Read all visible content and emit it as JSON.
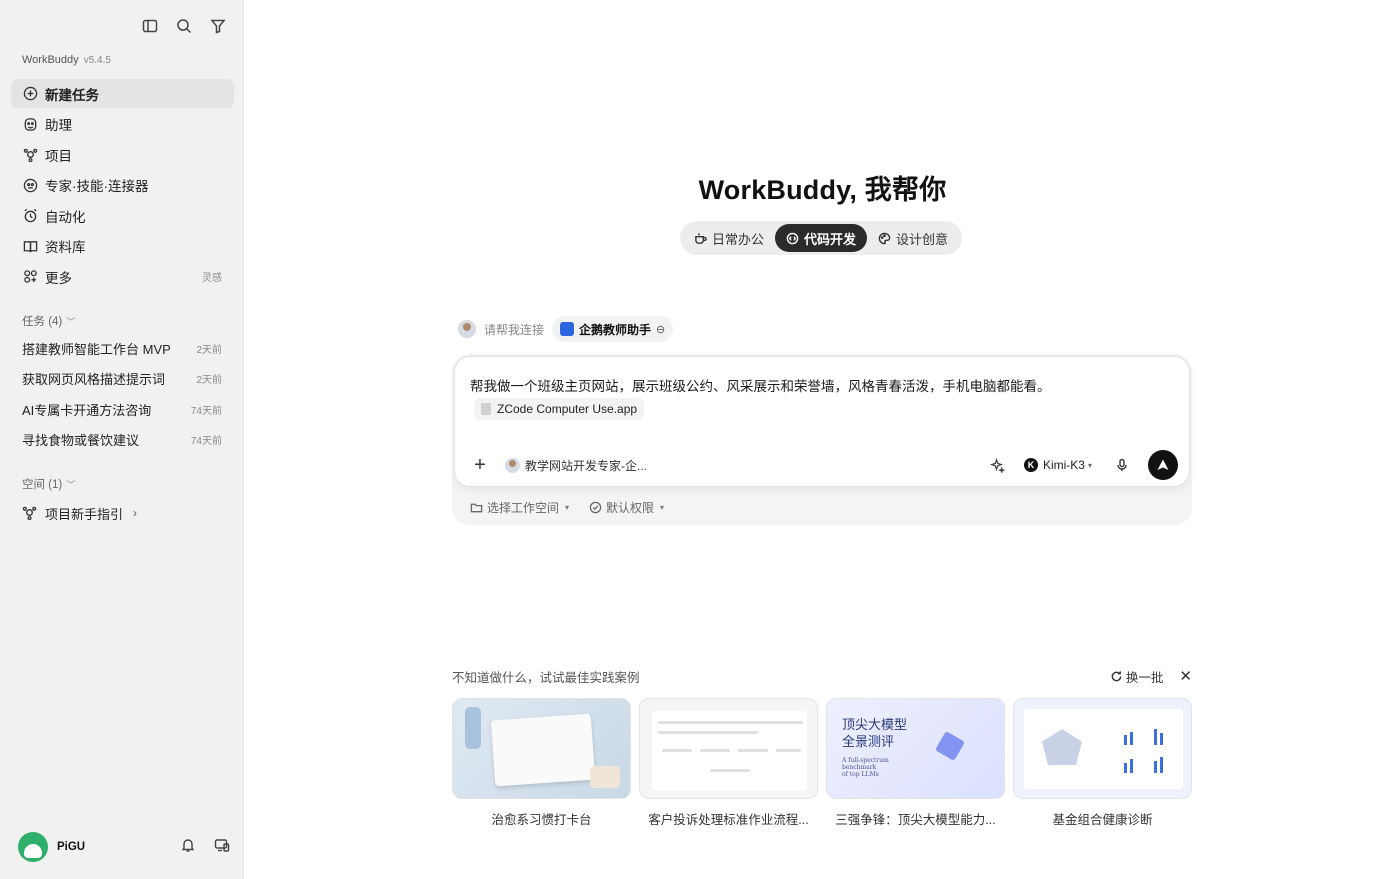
{
  "sidebar": {
    "app_name": "WorkBuddy",
    "app_version": "v5.4.5",
    "nav": [
      {
        "label": "新建任务",
        "icon": "plus-circle-icon",
        "active": true
      },
      {
        "label": "助理",
        "icon": "assistant-icon",
        "active": false
      },
      {
        "label": "项目",
        "icon": "project-icon",
        "active": false
      },
      {
        "label": "专家·技能·连接器",
        "icon": "expert-icon",
        "active": false
      },
      {
        "label": "自动化",
        "icon": "alarm-clock-icon",
        "active": false
      },
      {
        "label": "资料库",
        "icon": "book-icon",
        "active": false
      },
      {
        "label": "更多",
        "icon": "grid-plus-icon",
        "active": false,
        "suffix": "灵感"
      }
    ],
    "tasks_header": "任务 (4)",
    "tasks": [
      {
        "title": "搭建教师智能工作台 MVP",
        "when": "2天前"
      },
      {
        "title": "获取网页风格描述提示词",
        "when": "2天前"
      },
      {
        "title": "AI专属卡开通方法咨询",
        "when": "74天前"
      },
      {
        "title": "寻找食物或餐饮建议",
        "when": "74天前"
      }
    ],
    "spaces_header": "空间 (1)",
    "spaces": [
      {
        "label": "项目新手指引"
      }
    ],
    "user": {
      "name": "PiGU"
    }
  },
  "main": {
    "title": "WorkBuddy, 我帮你",
    "modes": [
      {
        "label": "日常办公",
        "icon": "cup-icon",
        "active": false
      },
      {
        "label": "代码开发",
        "icon": "code-icon",
        "active": true
      },
      {
        "label": "设计创意",
        "icon": "palette-icon",
        "active": false
      }
    ],
    "connect_prompt": "请帮我连接",
    "connector": "企鹅教师助手",
    "prompt": "帮我做一个班级主页网站，展示班级公约、风采展示和荣誉墙，风格青春活泼，手机电脑都能看。",
    "attachment": "ZCode Computer Use.app",
    "agent": "教学网站开发专家-企...",
    "model": "Kimi-K3",
    "workspace_select": "选择工作空间",
    "permission_select": "默认权限",
    "examples_title": "不知道做什么，试试最佳实践案例",
    "refresh_label": "换一批",
    "examples": [
      {
        "caption": "治愈系习惯打卡台"
      },
      {
        "caption": "客户投诉处理标准作业流程..."
      },
      {
        "caption": "三强争锋：顶尖大模型能力..."
      },
      {
        "caption": "基金组合健康诊断"
      }
    ],
    "example3_thumb": {
      "title_line1": "顶尖大模型",
      "title_line2": "全景测评",
      "sub1": "A full-spectrum",
      "sub2": "benchmark",
      "sub3": "of top LLMs"
    }
  },
  "colors": {
    "sidebar_bg": "#f1f1f1",
    "active_tab_bg": "#2b2b2b",
    "send_button": "#111111"
  }
}
